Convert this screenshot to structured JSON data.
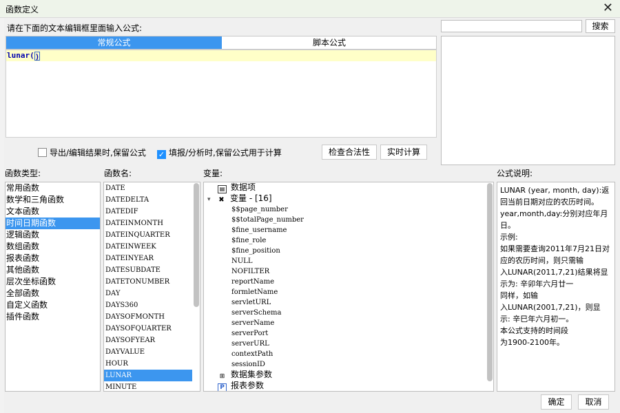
{
  "window": {
    "title": "函数定义",
    "close_glyph": "✕"
  },
  "editor": {
    "prompt": "请在下面的文本编辑框里面输入公式:",
    "tabs": [
      {
        "label": "常规公式",
        "active": true
      },
      {
        "label": "脚本公式",
        "active": false
      }
    ],
    "formula_prefix": "lunar(",
    "formula_cursor_char": ")"
  },
  "search": {
    "value": "",
    "button_label": "搜索"
  },
  "options": {
    "export_keep_formula": {
      "label": "导出/编辑结果时,保留公式",
      "checked": false
    },
    "fill_keep_formula": {
      "label": "填报/分析时,保留公式用于计算",
      "checked": true
    },
    "check_button": "检查合法性",
    "realtime_button": "实时计算"
  },
  "labels": {
    "function_type": "函数类型:",
    "function_name": "函数名:",
    "variables": "变量:",
    "formula_desc": "公式说明:"
  },
  "function_types": [
    "常用函数",
    "数学和三角函数",
    "文本函数",
    "时间日期函数",
    "逻辑函数",
    "数组函数",
    "报表函数",
    "其他函数",
    "层次坐标函数",
    "全部函数",
    "自定义函数",
    "插件函数"
  ],
  "selected_function_type": "时间日期函数",
  "function_names": [
    "DATE",
    "DATEDELTA",
    "DATEDIF",
    "DATEINMONTH",
    "DATEINQUARTER",
    "DATEINWEEK",
    "DATEINYEAR",
    "DATESUBDATE",
    "DATETONUMBER",
    "DAY",
    "DAYS360",
    "DAYSOFMONTH",
    "DAYSOFQUARTER",
    "DAYSOFYEAR",
    "DAYVALUE",
    "HOUR",
    "LUNAR",
    "MINUTE"
  ],
  "selected_function_name": "LUNAR",
  "variables": {
    "data_item": "数据项",
    "var_group": "变量 - [16]",
    "var_items": [
      "$$page_number",
      "$$totalPage_number",
      "$fine_username",
      "$fine_role",
      "$fine_position",
      "NULL",
      "NOFILTER",
      "reportName",
      "formletName",
      "servletURL",
      "serverSchema",
      "serverName",
      "serverPort",
      "serverURL",
      "contextPath",
      "sessionID"
    ],
    "dataset_params": "数据集参数",
    "report_params": "报表参数"
  },
  "description_lines": [
    "LUNAR (year, month, day):返",
    "回当前日期对应的农历时间。",
    "year,month,day:分别对应年月",
    "日。",
    "示例:",
    "如果需要查询2011年7月21日对",
    "应的农历时间，则只需输",
    "入LUNAR(2011,7,21)结果将显",
    "示为: 辛卯年六月廿一",
    "同样，如输",
    "入LUNAR(2001,7,21)，则显",
    "示: 辛巳年六月初一。",
    "本公式支持的时间段",
    "为1900-2100年。"
  ],
  "footer": {
    "ok": "确定",
    "cancel": "取消"
  },
  "colors": {
    "accent": "#3c96ef",
    "editor_highlight": "#ffffc8",
    "formula_text": "#0000b0"
  }
}
